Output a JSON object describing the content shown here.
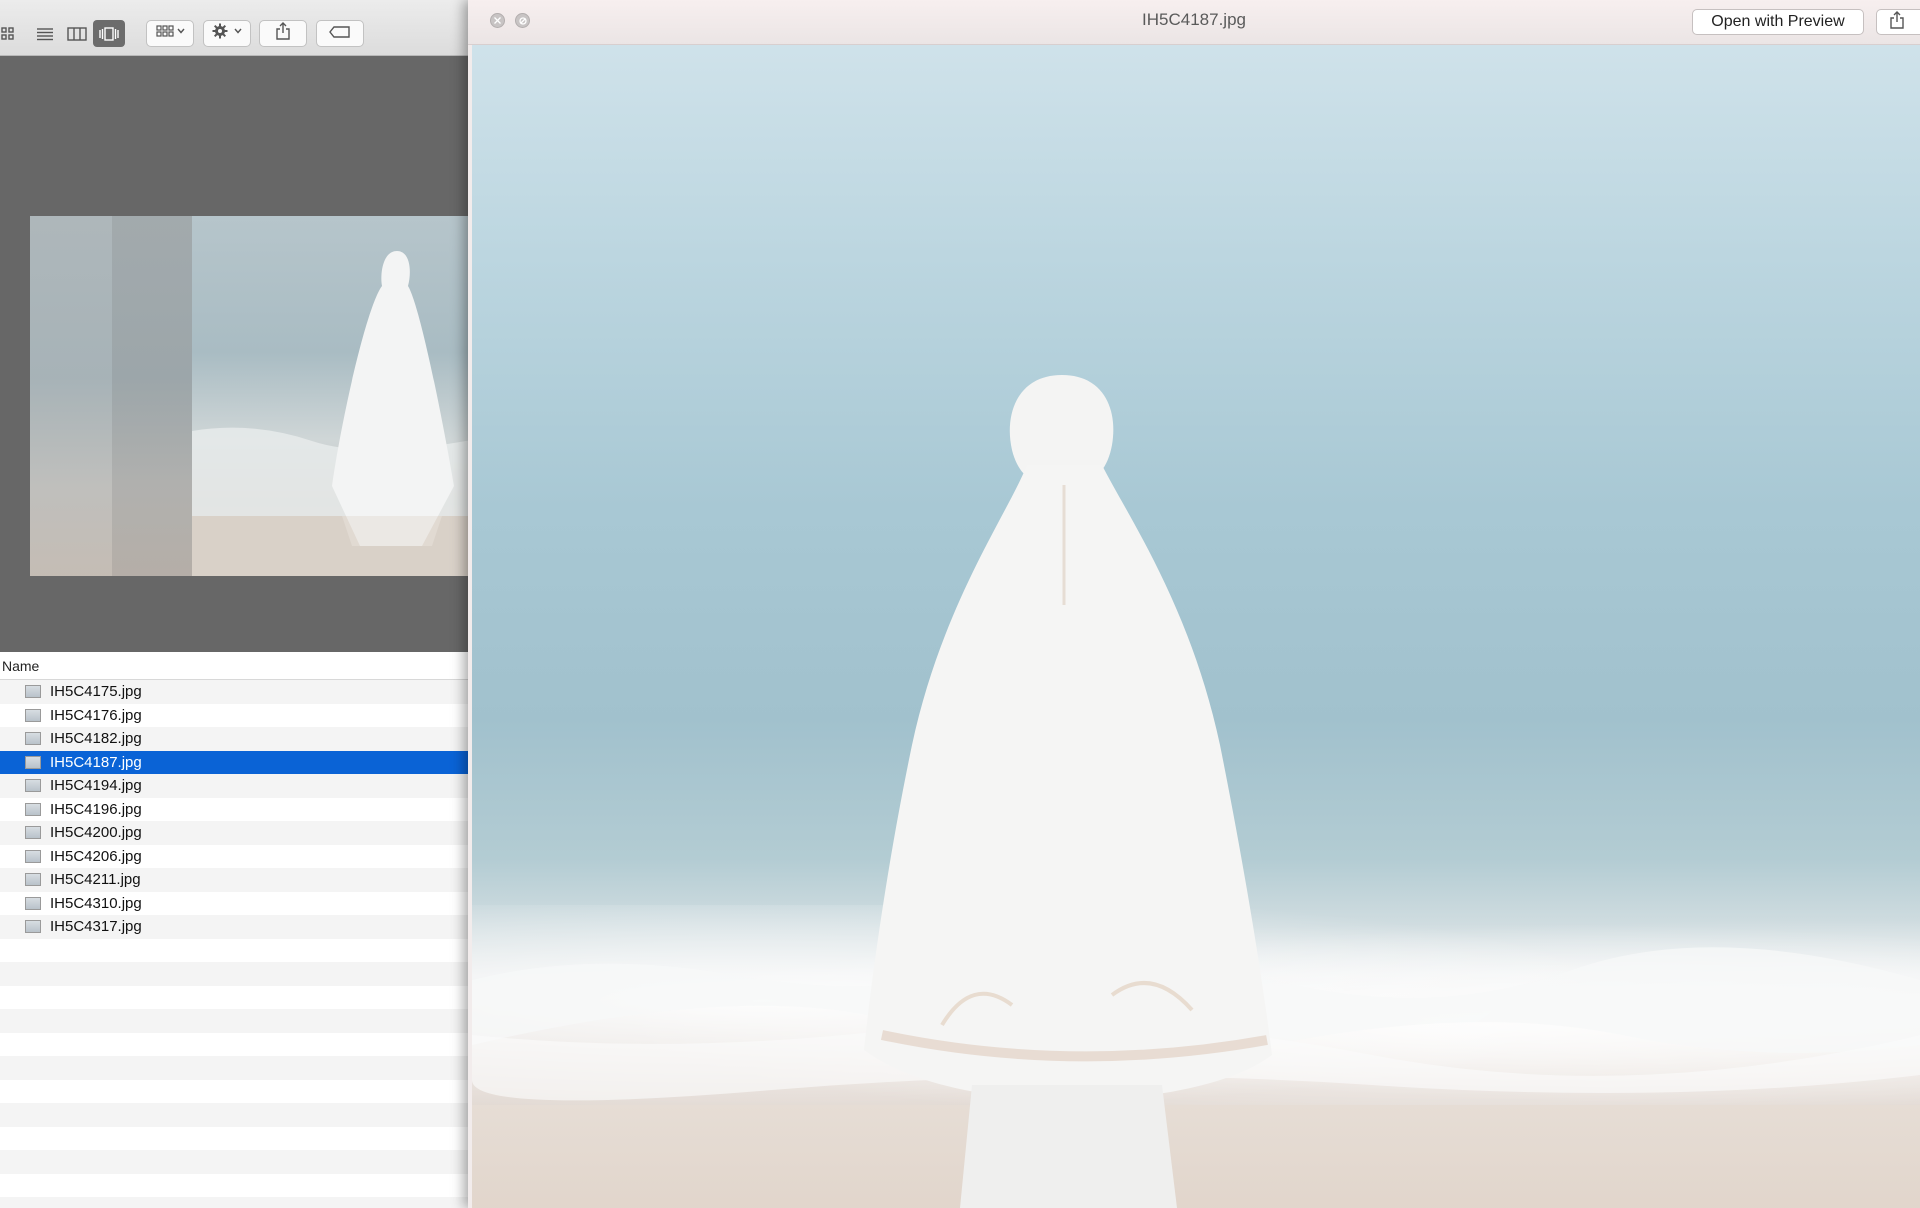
{
  "finder": {
    "list_header": "Name",
    "files": [
      {
        "name": "IH5C4175.jpg",
        "selected": false
      },
      {
        "name": "IH5C4176.jpg",
        "selected": false
      },
      {
        "name": "IH5C4182.jpg",
        "selected": false
      },
      {
        "name": "IH5C4187.jpg",
        "selected": true
      },
      {
        "name": "IH5C4194.jpg",
        "selected": false
      },
      {
        "name": "IH5C4196.jpg",
        "selected": false
      },
      {
        "name": "IH5C4200.jpg",
        "selected": false
      },
      {
        "name": "IH5C4206.jpg",
        "selected": false
      },
      {
        "name": "IH5C4211.jpg",
        "selected": false
      },
      {
        "name": "IH5C4310.jpg",
        "selected": false
      },
      {
        "name": "IH5C4317.jpg",
        "selected": false
      }
    ],
    "toolbar": {
      "view_icons": [
        "icon-view-icon",
        "list-view-icon",
        "column-view-icon",
        "cover-flow-view-icon"
      ],
      "active_view": "cover-flow-view-icon",
      "buttons": [
        "arrange-icon",
        "gear-icon",
        "share-icon",
        "tag-icon"
      ]
    }
  },
  "quicklook": {
    "title": "IH5C4187.jpg",
    "open_button": "Open with Preview",
    "controls": [
      "close-icon",
      "fullscreen-icon"
    ],
    "share": "share-icon"
  },
  "colors": {
    "selection": "#0a63d6",
    "coverflow_bg": "#676767"
  }
}
